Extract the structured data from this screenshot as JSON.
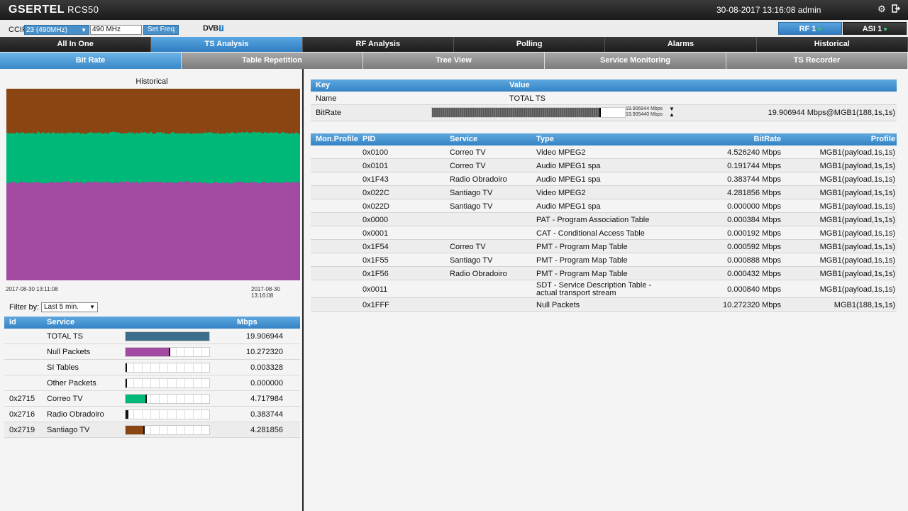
{
  "header": {
    "brand": "GSERTEL",
    "model": "RCS50",
    "datetime": "30-08-2017 13:16:08 admin",
    "icons": [
      "gear-icon",
      "logout-icon"
    ]
  },
  "toolbar": {
    "ccir_label": "CCIR",
    "channel_selected": "23 (490MHz)",
    "frequency_value": "490 MHz",
    "set_freq_label": "Set Freq",
    "dvb_label": "DVB",
    "dvb_suffix": "T",
    "rf_label": "RF 1",
    "asi_label": "ASI 1"
  },
  "main_tabs": [
    {
      "label": "All In One",
      "active": false
    },
    {
      "label": "TS Analysis",
      "active": true
    },
    {
      "label": "RF Analysis",
      "active": false
    },
    {
      "label": "Polling",
      "active": false
    },
    {
      "label": "Alarms",
      "active": false
    },
    {
      "label": "Historical",
      "active": false
    }
  ],
  "sub_tabs": [
    {
      "label": "Bit Rate",
      "active": true
    },
    {
      "label": "Table Repetition",
      "active": false
    },
    {
      "label": "Tree View",
      "active": false
    },
    {
      "label": "Service Monitoring",
      "active": false
    },
    {
      "label": "TS Recorder",
      "active": false
    }
  ],
  "historical": {
    "title": "Historical",
    "time_start": "2017-08-30 13:11:08",
    "time_end": "2017-08-30 13:16:08",
    "layers": [
      {
        "service": "Correo TV",
        "color": "#8b4513",
        "share": 0.237
      },
      {
        "service": "Santiago TV",
        "color": "#00b877",
        "share": 0.258
      },
      {
        "service": "Null Packets",
        "color": "#a24aa1",
        "share": 0.505
      }
    ]
  },
  "filter": {
    "label": "Filter by:",
    "selected": "Last 5 min."
  },
  "services_table": {
    "headers": {
      "id": "Id",
      "service": "Service",
      "mbps": "Mbps"
    },
    "rows": [
      {
        "id": "",
        "name": "TOTAL TS",
        "value": "19.906944",
        "color": "#3c6e8c",
        "fraction": 1.0
      },
      {
        "id": "",
        "name": "Null Packets",
        "value": "10.272320",
        "color": "#a24aa1",
        "fraction": 0.516
      },
      {
        "id": "",
        "name": "SI Tables",
        "value": "0.003328",
        "color": "#111111",
        "fraction": 0.0
      },
      {
        "id": "",
        "name": "Other Packets",
        "value": "0.000000",
        "color": "#111111",
        "fraction": 0.0
      },
      {
        "id": "0x2715",
        "name": "Correo TV",
        "value": "4.717984",
        "color": "#00b877",
        "fraction": 0.237
      },
      {
        "id": "0x2716",
        "name": "Radio Obradoiro",
        "value": "0.383744",
        "color": "#111111",
        "fraction": 0.019
      },
      {
        "id": "0x2719",
        "name": "Santiago TV",
        "value": "4.281856",
        "color": "#8b4513",
        "fraction": 0.215
      }
    ]
  },
  "kv_table": {
    "headers": {
      "key": "Key",
      "value": "Value"
    },
    "name_key": "Name",
    "name_value": "TOTAL TS",
    "bitrate_key": "BitRate",
    "bitrate_max": "19.906944 Mbps",
    "bitrate_min": "19.905440 Mbps",
    "bitrate_value": "19.906944 Mbps@MGB1(188,1s,1s)",
    "bitrate_fraction": 0.866
  },
  "pid_table": {
    "headers": {
      "mon": "Mon.Profile",
      "pid": "PID",
      "service": "Service",
      "type": "Type",
      "bitrate": "BitRate",
      "profile": "Profile"
    },
    "rows": [
      {
        "pid": "0x0100",
        "service": "Correo TV",
        "type": "Video MPEG2",
        "bitrate": "4.526240 Mbps",
        "profile": "MGB1(payload,1s,1s)"
      },
      {
        "pid": "0x0101",
        "service": "Correo TV",
        "type": "Audio MPEG1 spa",
        "bitrate": "0.191744 Mbps",
        "profile": "MGB1(payload,1s,1s)"
      },
      {
        "pid": "0x1F43",
        "service": "Radio Obradoiro",
        "type": "Audio MPEG1 spa",
        "bitrate": "0.383744 Mbps",
        "profile": "MGB1(payload,1s,1s)"
      },
      {
        "pid": "0x022C",
        "service": "Santiago TV",
        "type": "Video MPEG2",
        "bitrate": "4.281856 Mbps",
        "profile": "MGB1(payload,1s,1s)"
      },
      {
        "pid": "0x022D",
        "service": "Santiago TV",
        "type": "Audio MPEG1 spa",
        "bitrate": "0.000000 Mbps",
        "profile": "MGB1(payload,1s,1s)"
      },
      {
        "pid": "0x0000",
        "service": "",
        "type": "PAT - Program Association Table",
        "bitrate": "0.000384 Mbps",
        "profile": "MGB1(payload,1s,1s)"
      },
      {
        "pid": "0x0001",
        "service": "",
        "type": "CAT - Conditional Access Table",
        "bitrate": "0.000192 Mbps",
        "profile": "MGB1(payload,1s,1s)"
      },
      {
        "pid": "0x1F54",
        "service": "Correo TV",
        "type": "PMT - Program Map Table",
        "bitrate": "0.000592 Mbps",
        "profile": "MGB1(payload,1s,1s)"
      },
      {
        "pid": "0x1F55",
        "service": "Santiago TV",
        "type": "PMT - Program Map Table",
        "bitrate": "0.000888 Mbps",
        "profile": "MGB1(payload,1s,1s)"
      },
      {
        "pid": "0x1F56",
        "service": "Radio Obradoiro",
        "type": "PMT - Program Map Table",
        "bitrate": "0.000432 Mbps",
        "profile": "MGB1(payload,1s,1s)"
      },
      {
        "pid": "0x0011",
        "service": "",
        "type": "SDT - Service Description Table - actual transport stream",
        "bitrate": "0.000840 Mbps",
        "profile": "MGB1(payload,1s,1s)"
      },
      {
        "pid": "0x1FFF",
        "service": "",
        "type": "Null Packets",
        "bitrate": "10.272320 Mbps",
        "profile": "MGB1(188,1s,1s)"
      }
    ]
  }
}
